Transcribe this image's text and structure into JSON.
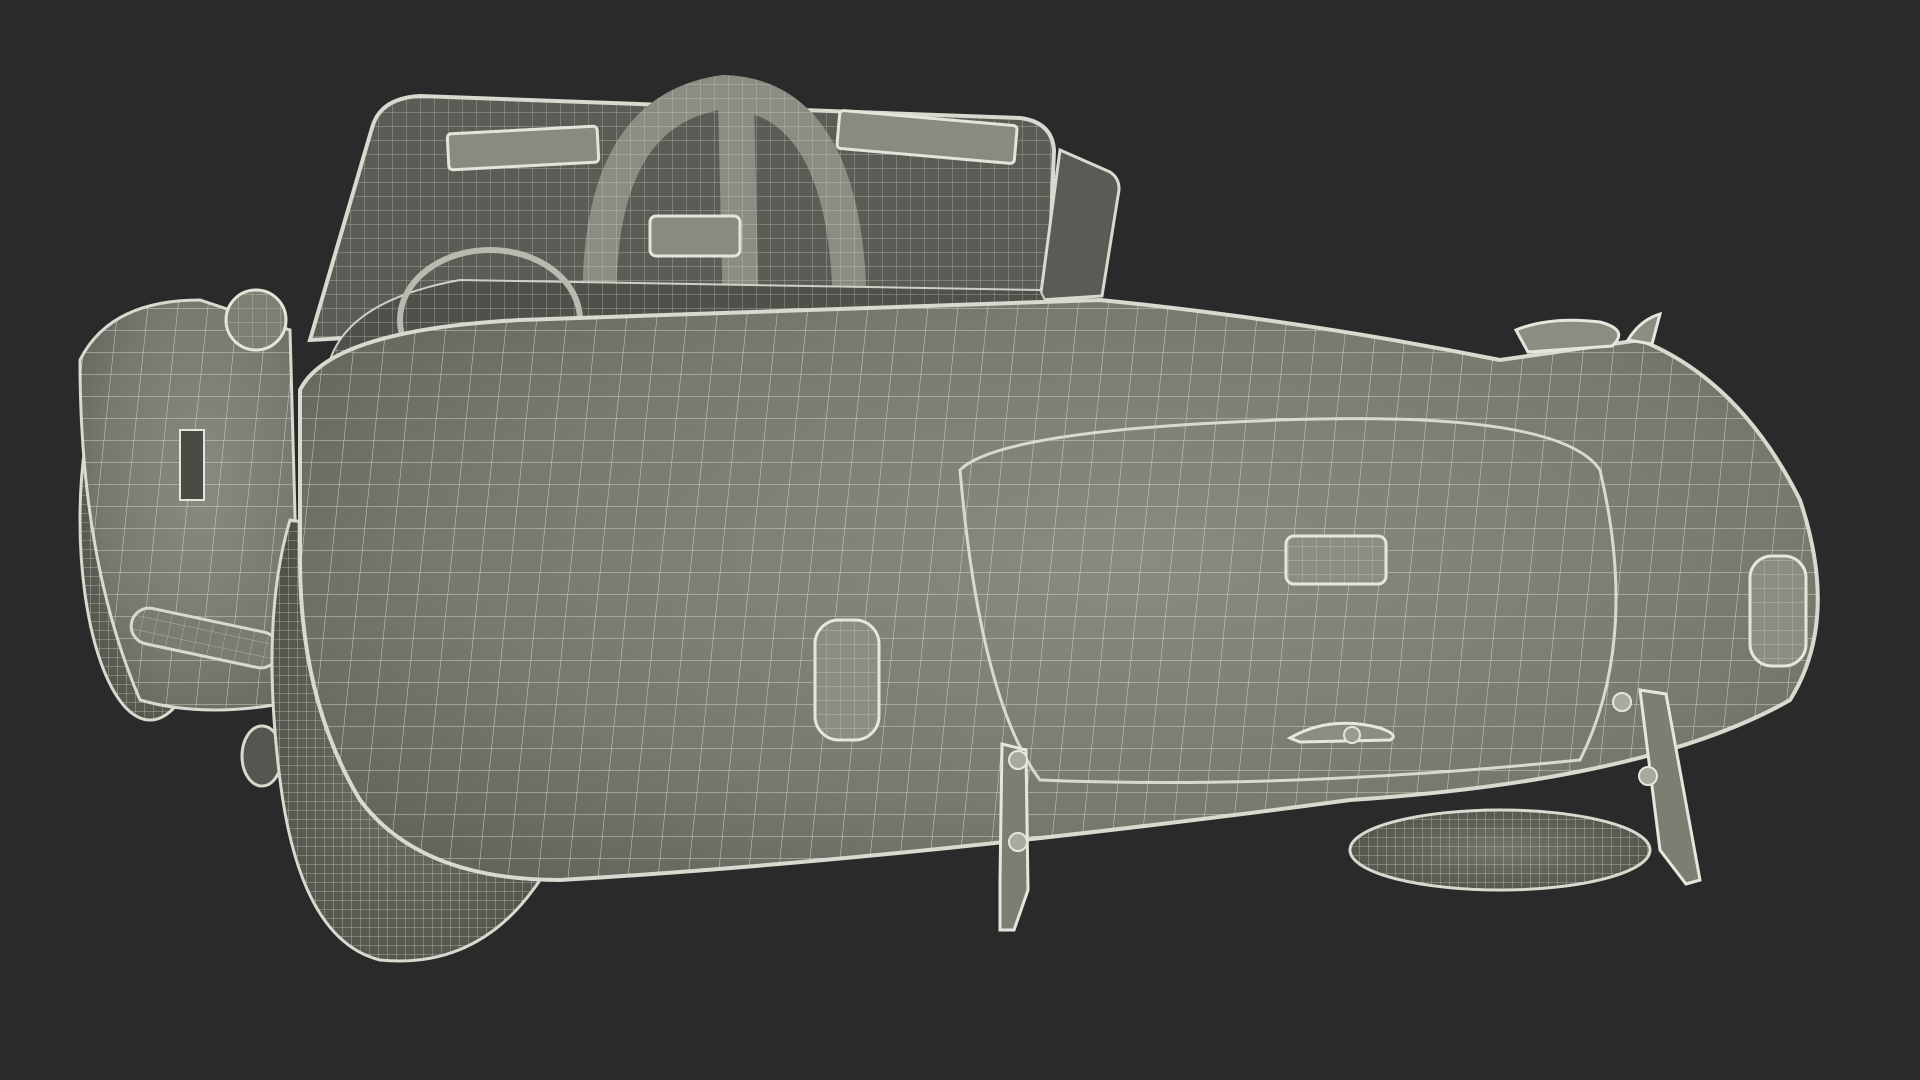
{
  "scene": {
    "subject": "wireframe-render-of-roadster-rear-view",
    "colors": {
      "background": "#2a2a2a",
      "body_fill": "#7e7f74",
      "body_shadow": "#5f605a",
      "interior_fill": "#55564f",
      "wire": "#e4e4da",
      "wire_dim": "#b9b9af",
      "tire_fill": "#6b6c64",
      "outline": "#d9d9cf"
    }
  }
}
